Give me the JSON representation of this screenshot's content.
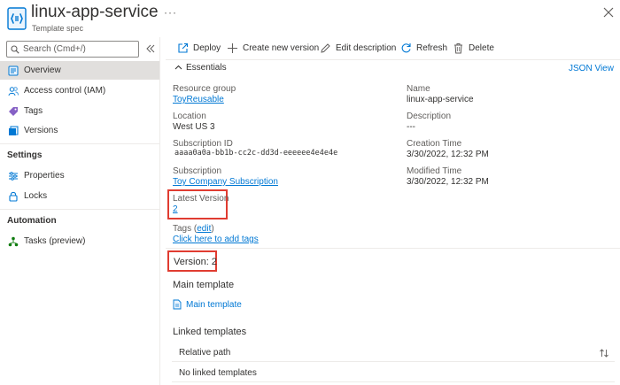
{
  "header": {
    "title": "linux-app-service",
    "subtitle": "Template spec",
    "more": "···"
  },
  "sidebar": {
    "search_placeholder": "Search (Cmd+/)",
    "items": [
      {
        "label": "Overview"
      },
      {
        "label": "Access control (IAM)"
      },
      {
        "label": "Tags"
      },
      {
        "label": "Versions"
      }
    ],
    "settings_heading": "Settings",
    "settings_items": [
      {
        "label": "Properties"
      },
      {
        "label": "Locks"
      }
    ],
    "automation_heading": "Automation",
    "automation_items": [
      {
        "label": "Tasks (preview)"
      }
    ]
  },
  "toolbar": {
    "deploy": "Deploy",
    "create_version": "Create new version",
    "edit_description": "Edit description",
    "refresh": "Refresh",
    "delete": "Delete"
  },
  "essentials": {
    "heading": "Essentials",
    "json_view": "JSON View",
    "resource_group_label": "Resource group",
    "resource_group_value": "ToyReusable",
    "location_label": "Location",
    "location_value": "West US 3",
    "subscription_id_label": "Subscription ID",
    "subscription_id_value": "aaaa0a0a-bb1b-cc2c-dd3d-eeeeee4e4e4e",
    "subscription_label": "Subscription",
    "subscription_value": "Toy Company Subscription",
    "latest_version_label": "Latest Version",
    "latest_version_value": "2",
    "name_label": "Name",
    "name_value": "linux-app-service",
    "description_label": "Description",
    "description_value": "---",
    "creation_time_label": "Creation Time",
    "creation_time_value": "3/30/2022, 12:32 PM",
    "modified_time_label": "Modified Time",
    "modified_time_value": "3/30/2022, 12:32 PM",
    "tags_label": "Tags",
    "tags_edit": "edit",
    "tags_add": "Click here to add tags"
  },
  "version": {
    "title": "Version: 2",
    "main_template_heading": "Main template",
    "main_template_link": "Main template",
    "linked_heading": "Linked templates",
    "table_header": "Relative path",
    "empty_row": "No linked templates"
  },
  "colors": {
    "accent": "#0078d4",
    "highlight": "#e03c31"
  }
}
